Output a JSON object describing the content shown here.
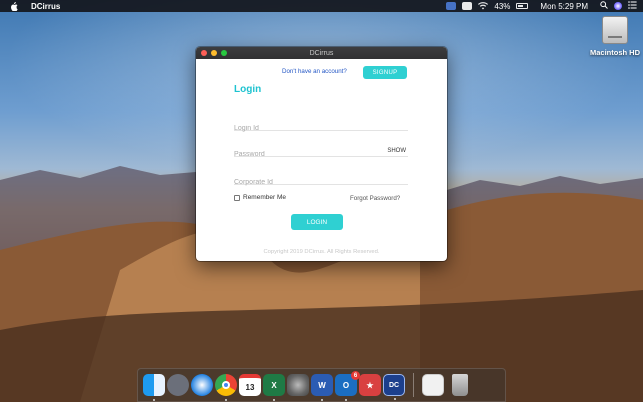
{
  "menubar": {
    "app_name": "DCirrus",
    "battery": "43%",
    "clock": "Mon 5:29 PM"
  },
  "desktop": {
    "drive_label": "Macintosh HD"
  },
  "window": {
    "title": "DCirrus",
    "signup_prompt": "Don't have an account?",
    "signup_label": "SIGNUP",
    "heading": "Login",
    "login_id_placeholder": "Login Id",
    "password_placeholder": "Password",
    "show_label": "SHOW",
    "corporate_id_placeholder": "Corporate Id",
    "remember_label": "Remember Me",
    "forgot_label": "Forgot Password?",
    "login_label": "LOGIN",
    "copyright": "Copyright 2019 DCirrus. All Rights Reserved."
  },
  "dock": {
    "calendar_day": "13",
    "outlook_badge": "6",
    "word_letter": "W",
    "excel_letter": "X",
    "outlook_letter": "O",
    "dc_letter": "DC"
  },
  "colors": {
    "accent": "#2fd0d2",
    "heading": "#1ec3d0",
    "link": "#2457c5"
  }
}
